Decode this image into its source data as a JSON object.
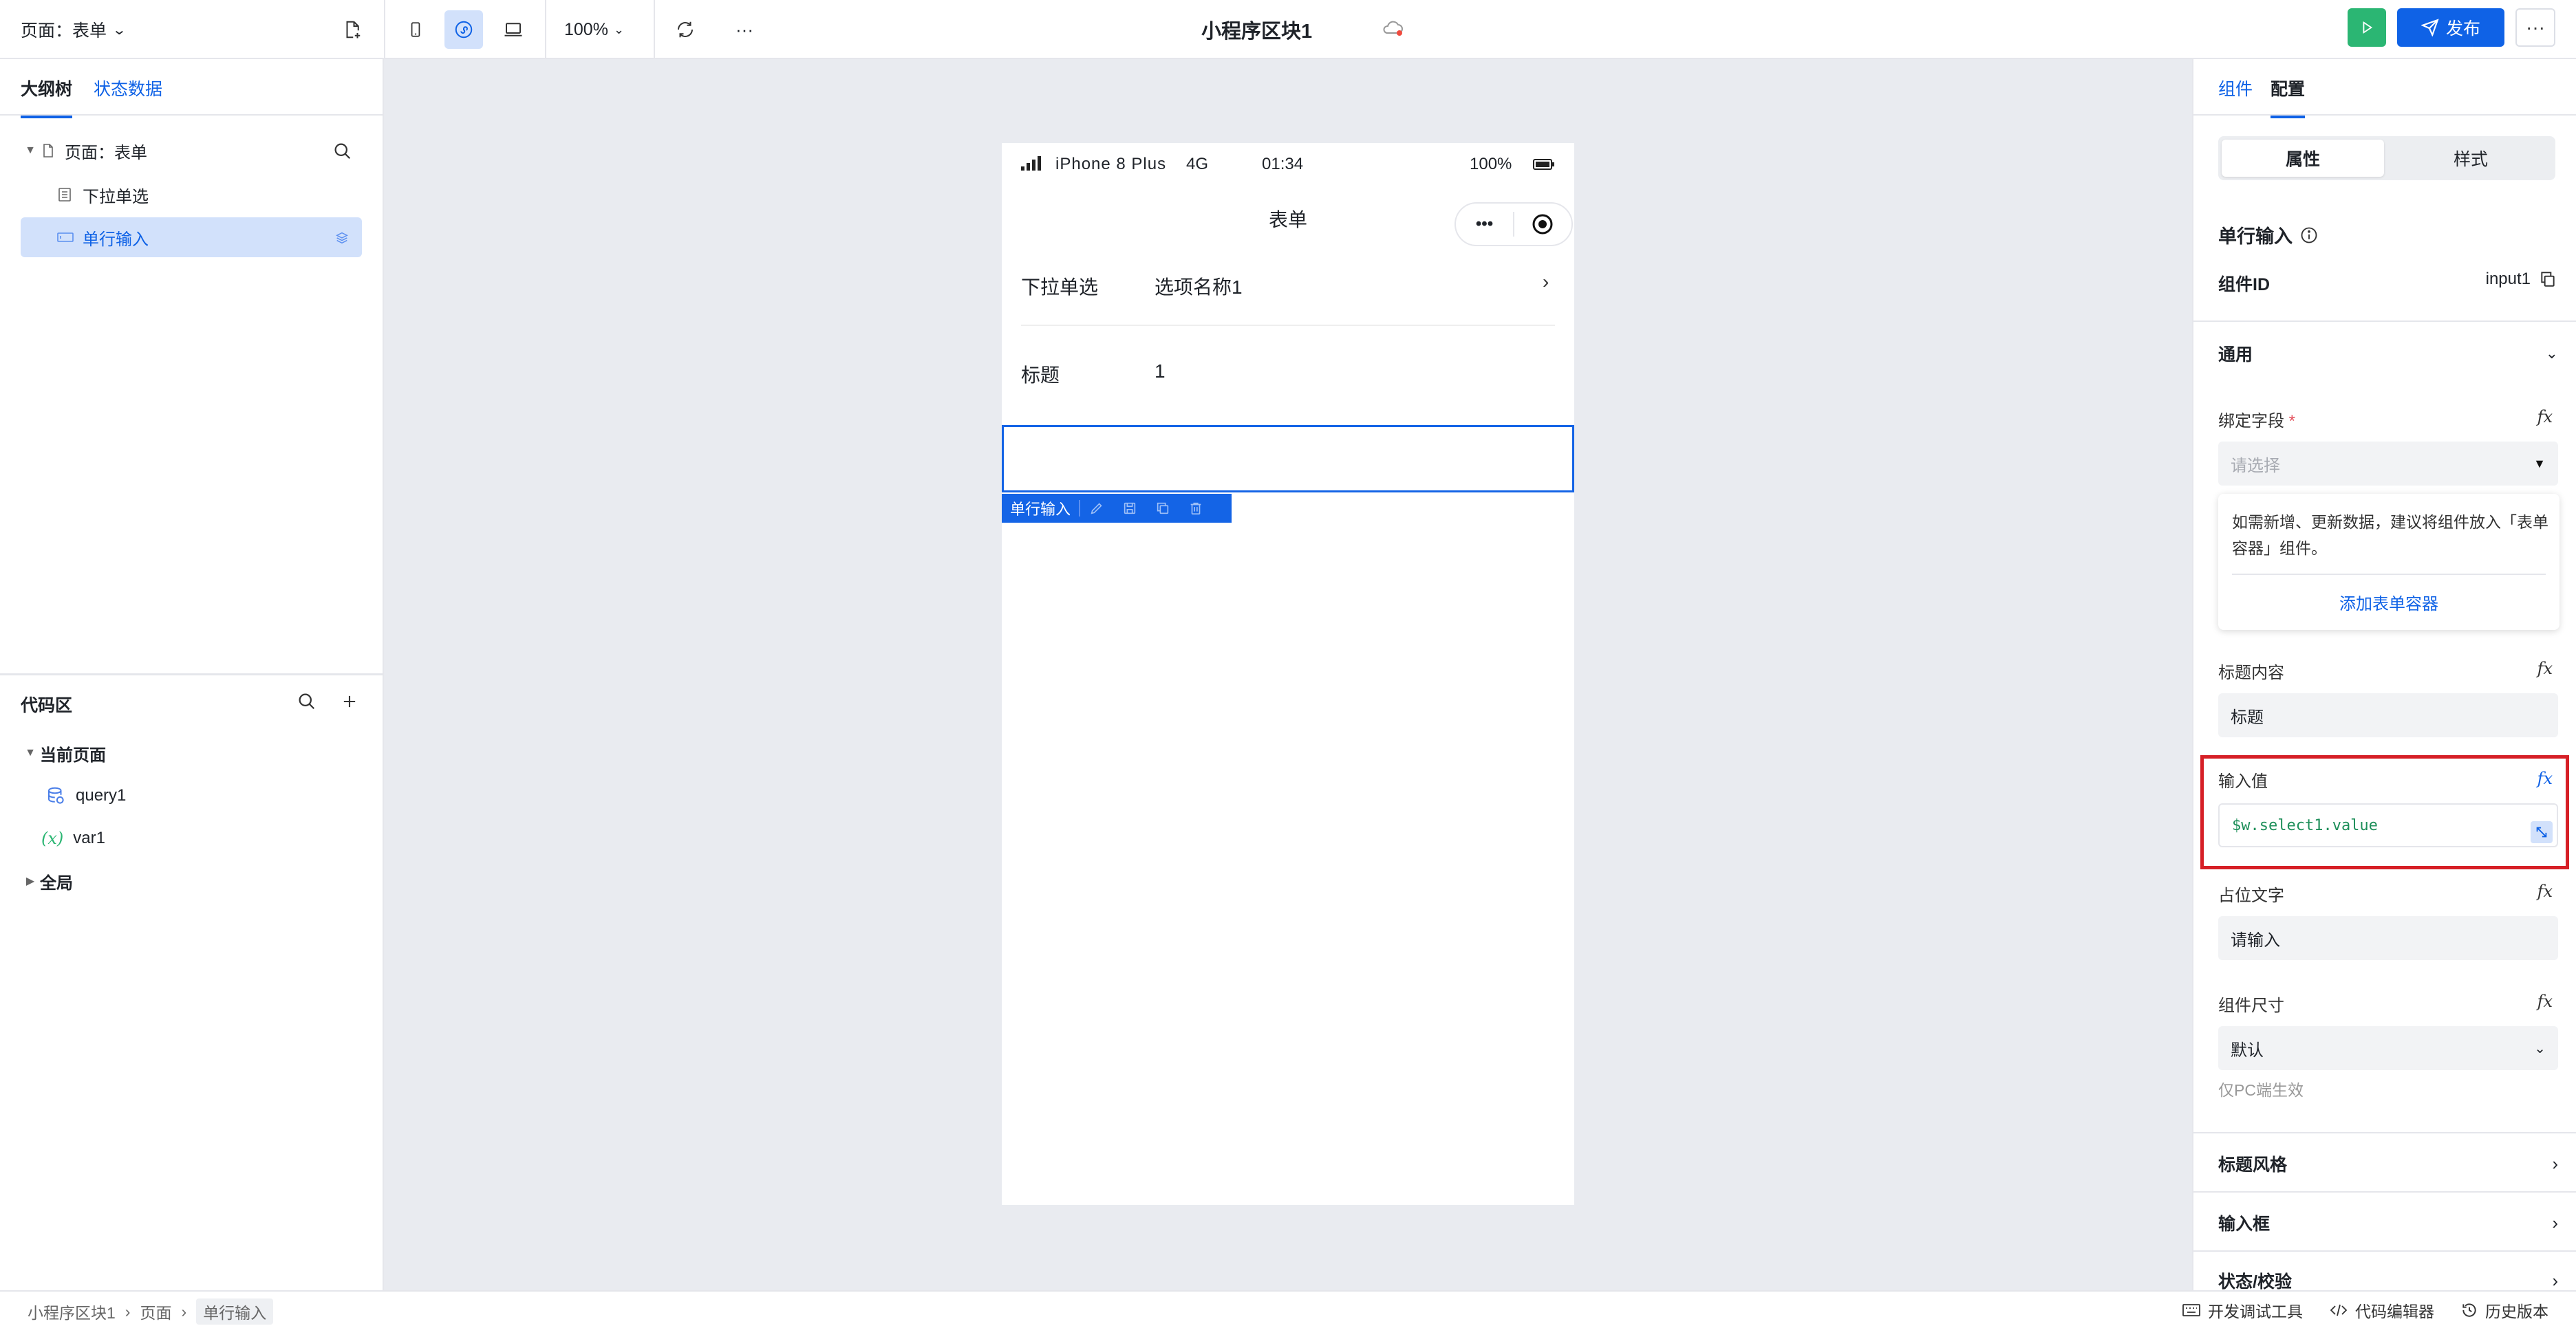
{
  "topbar": {
    "page_selector": "页面：表单",
    "zoom": "100%",
    "app_title": "小程序区块1",
    "publish_label": "发布",
    "more": "···"
  },
  "left": {
    "tabs": [
      "大纲树",
      "状态数据"
    ],
    "tree": [
      {
        "label": "页面：表单"
      },
      {
        "label": "下拉单选"
      },
      {
        "label": "单行输入"
      }
    ],
    "code_area": {
      "title": "代码区",
      "current_page": "当前页面",
      "items": [
        "query1",
        "var1"
      ],
      "global": "全局",
      "var_icon": "(x)"
    }
  },
  "phone": {
    "carrier": "iPhone 8 Plus",
    "network": "4G",
    "time": "01:34",
    "battery": "100%",
    "nav_title": "表单",
    "capsule_more": "•••",
    "rows": [
      {
        "label": "下拉单选",
        "value": "选项名称1"
      },
      {
        "label": "标题",
        "value": "1"
      }
    ],
    "selected_component": "单行输入"
  },
  "right": {
    "tabs": [
      "组件",
      "配置"
    ],
    "segments": [
      "属性",
      "样式"
    ],
    "component_name": "单行输入",
    "id_label": "组件ID",
    "id_value": "input1",
    "general": "通用",
    "bind_field": {
      "label": "绑定字段",
      "required": "*",
      "placeholder": "请选择"
    },
    "tip": {
      "text": "如需新增、更新数据，建议将组件放入「表单容器」组件。",
      "link": "添加表单容器"
    },
    "title_content": {
      "label": "标题内容",
      "value": "标题"
    },
    "input_value": {
      "label": "输入值",
      "value": "$w.select1.value"
    },
    "placeholder_text": {
      "label": "占位文字",
      "value": "请输入"
    },
    "size": {
      "label": "组件尺寸",
      "value": "默认",
      "hint": "仅PC端生效"
    },
    "fx": "fx",
    "sections": [
      "标题风格",
      "输入框",
      "状态/校验"
    ]
  },
  "bottom": {
    "breadcrumb": [
      "小程序区块1",
      "页面",
      "单行输入"
    ],
    "tools": [
      "开发调试工具",
      "代码编辑器",
      "历史版本"
    ]
  },
  "colors": {
    "accent": "#0f62e6",
    "run": "#2bb673",
    "highlight": "#d61f26",
    "selection": "#d2e1fb",
    "canvas": "#e9ebf0"
  }
}
